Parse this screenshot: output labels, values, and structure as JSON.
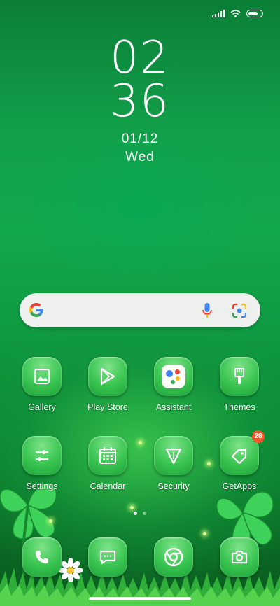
{
  "status": {
    "icons": [
      "signal-icon",
      "wifi-icon",
      "battery-icon"
    ],
    "battery_level": 0.85
  },
  "clock": {
    "hours": "02",
    "minutes": "36",
    "date": "01/12",
    "day": "Wed"
  },
  "search": {
    "icons": [
      "google-logo-icon",
      "mic-icon",
      "lens-icon"
    ]
  },
  "apps": [
    {
      "label": "Gallery",
      "icon": "gallery-icon"
    },
    {
      "label": "Play Store",
      "icon": "play-store-icon"
    },
    {
      "label": "Assistant",
      "icon": "assistant-icon"
    },
    {
      "label": "Themes",
      "icon": "themes-icon"
    },
    {
      "label": "Settings",
      "icon": "settings-icon"
    },
    {
      "label": "Calendar",
      "icon": "calendar-icon"
    },
    {
      "label": "Security",
      "icon": "security-icon"
    },
    {
      "label": "GetApps",
      "icon": "getapps-icon",
      "badge": "28"
    }
  ],
  "dock": [
    {
      "icon": "phone-icon"
    },
    {
      "icon": "messages-icon"
    },
    {
      "icon": "chrome-icon"
    },
    {
      "icon": "camera-icon"
    }
  ],
  "page_indicator": {
    "count": 2,
    "active": 1
  }
}
